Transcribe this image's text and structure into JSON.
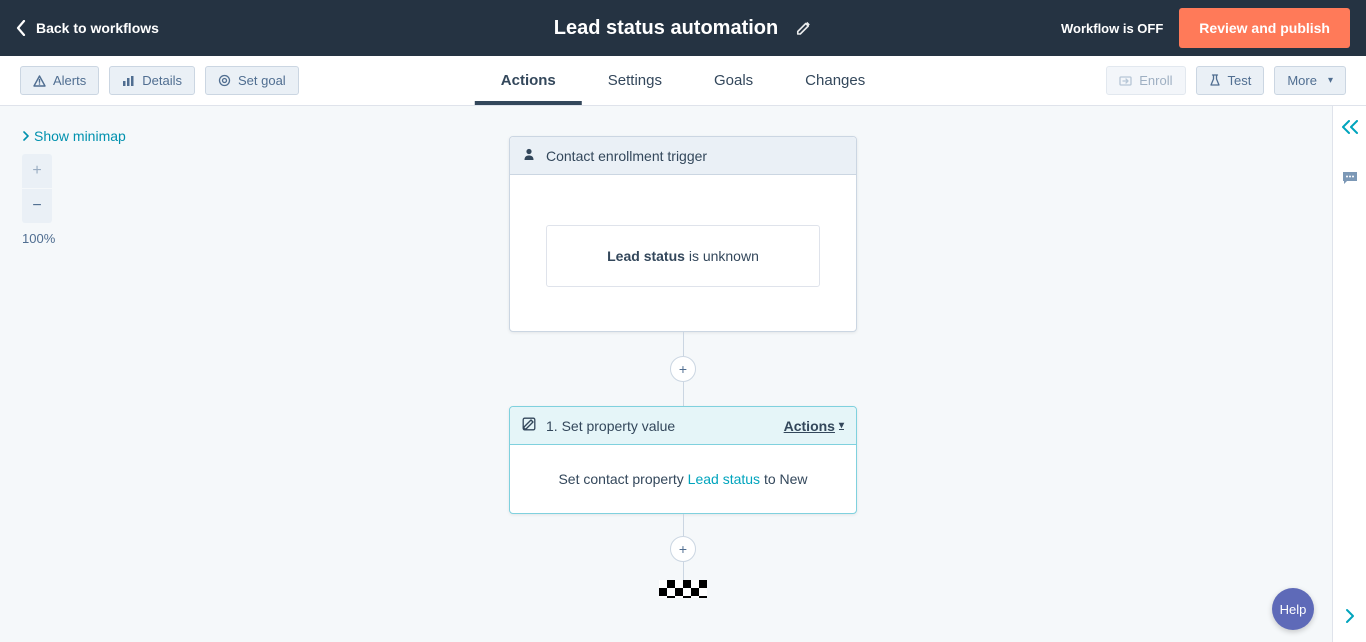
{
  "header": {
    "back_label": "Back to workflows",
    "title": "Lead status automation",
    "status": "Workflow is OFF",
    "publish_label": "Review and publish"
  },
  "toolbar": {
    "alerts_label": "Alerts",
    "details_label": "Details",
    "set_goal_label": "Set goal",
    "tabs": {
      "actions": "Actions",
      "settings": "Settings",
      "goals": "Goals",
      "changes": "Changes"
    },
    "enroll_label": "Enroll",
    "test_label": "Test",
    "more_label": "More"
  },
  "canvas": {
    "minimap_label": "Show minimap",
    "zoom": "100%"
  },
  "trigger": {
    "header": "Contact enrollment trigger",
    "property": "Lead status",
    "condition": "is unknown"
  },
  "action": {
    "step_label": "1. Set property value",
    "menu_label": "Actions",
    "prefix": "Set contact property",
    "property": "Lead status",
    "middle": "to",
    "value": "New"
  },
  "help": {
    "label": "Help"
  }
}
